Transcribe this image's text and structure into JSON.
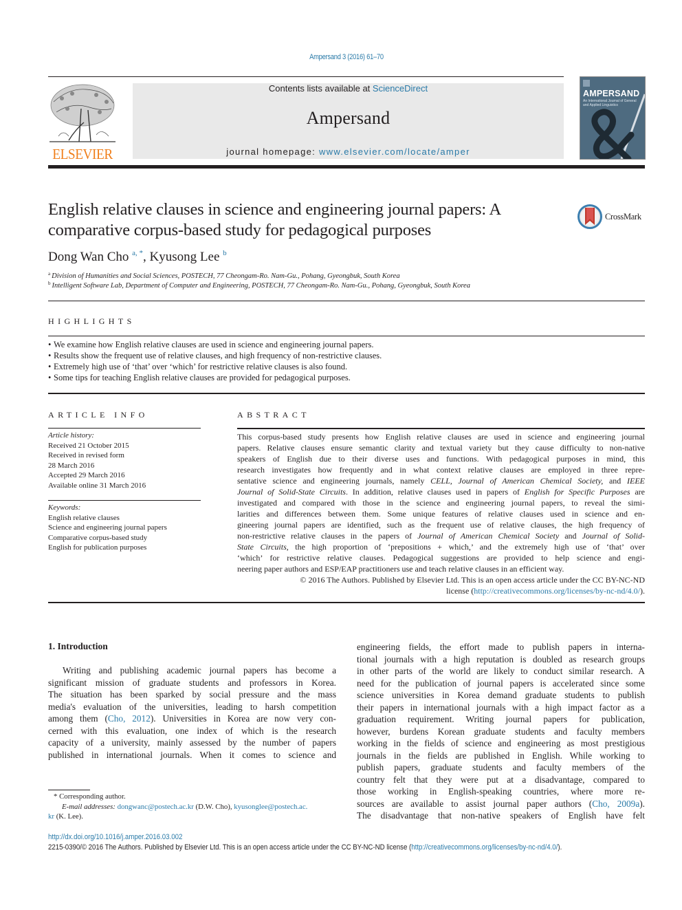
{
  "header": {
    "journal_ref": "Ampersand 3 (2016) 61–70",
    "contents_prefix": "Contents lists available at ",
    "contents_link": "ScienceDirect",
    "journal_name": "Ampersand",
    "homepage_prefix": "journal homepage: ",
    "homepage_link": "www.elsevier.com/locate/amper",
    "publisher_logo_text": "ELSEVIER",
    "cover_title": "AMPERSAND",
    "cover_subtitle": "An International Journal of General and Applied Linguistics"
  },
  "colors": {
    "link": "#2a7aa8",
    "elsevier_orange": "#f07f1b",
    "header_bg": "#e9e9e9",
    "cover_bg": "#4e6b80",
    "text": "#231f20"
  },
  "article": {
    "title": "English relative clauses in science and engineering journal papers: A comparative corpus-based study for pedagogical purposes",
    "crossmark_label": "CrossMark",
    "authors": [
      {
        "name": "Dong Wan Cho",
        "marks": "a, *"
      },
      {
        "name": "Kyusong Lee",
        "marks": "b"
      }
    ],
    "author_separator": ", ",
    "affiliations": [
      {
        "mark": "a",
        "text": "Division of Humanities and Social Sciences, POSTECH, 77 Cheongam-Ro. Nam-Gu., Pohang, Gyeongbuk, South Korea"
      },
      {
        "mark": "b",
        "text": "Intelligent Software Lab, Department of Computer and Engineering, POSTECH, 77 Cheongam-Ro. Nam-Gu., Pohang, Gyeongbuk, South Korea"
      }
    ]
  },
  "highlights": {
    "heading": "HIGHLIGHTS",
    "bullet": "•",
    "items": [
      "We examine how English relative clauses are used in science and engineering journal papers.",
      "Results show the frequent use of relative clauses, and high frequency of non-restrictive clauses.",
      "Extremely high use of ‘that’ over ‘which’ for restrictive relative clauses is also found.",
      "Some tips for teaching English relative clauses are provided for pedagogical purposes."
    ]
  },
  "article_info": {
    "heading": "ARTICLE INFO",
    "history_label": "Article history:",
    "history": [
      "Received 21 October 2015",
      "Received in revised form",
      "28 March 2016",
      "Accepted 29 March 2016",
      "Available online 31 March 2016"
    ],
    "keywords_label": "Keywords:",
    "keywords": [
      "English relative clauses",
      "Science and engineering journal papers",
      "Comparative corpus-based study",
      "English for publication purposes"
    ]
  },
  "abstract": {
    "heading": "ABSTRACT",
    "lines": [
      [
        {
          "t": "This corpus-based study presents how English relative clauses are used in science and engineering journal"
        }
      ],
      [
        {
          "t": "papers. Relative clauses ensure semantic clarity and textual variety but they cause difficulty to non-native"
        }
      ],
      [
        {
          "t": "speakers of English due to their diverse uses and functions. With pedagogical purposes in mind, this"
        }
      ],
      [
        {
          "t": "research investigates how frequently and in what context relative clauses are employed in three repre-"
        }
      ],
      [
        {
          "t": "sentative science and engineering journals, namely "
        },
        {
          "t": "CELL, Journal of American Chemical Society,",
          "i": true
        },
        {
          "t": " and "
        },
        {
          "t": "IEEE",
          "i": true
        }
      ],
      [
        {
          "t": "Journal of Solid-State Circuits",
          "i": true
        },
        {
          "t": ". In addition, relative clauses used in papers of "
        },
        {
          "t": "English for Specific Purposes",
          "i": true
        },
        {
          "t": " are"
        }
      ],
      [
        {
          "t": "investigated and compared with those in the science and engineering journal papers, to reveal the simi-"
        }
      ],
      [
        {
          "t": "larities and differences between them. Some unique features of relative clauses used in science and en-"
        }
      ],
      [
        {
          "t": "gineering journal papers are identified, such as the frequent use of relative clauses, the high frequency of"
        }
      ],
      [
        {
          "t": "non-restrictive relative clauses in the papers of "
        },
        {
          "t": "Journal of American Chemical Society",
          "i": true
        },
        {
          "t": " and "
        },
        {
          "t": "Journal of Solid-",
          "i": true
        }
      ],
      [
        {
          "t": "State Circuits",
          "i": true
        },
        {
          "t": ", the high proportion of ‘prepositions + which,’ and the extremely high use of ‘that’ over"
        }
      ],
      [
        {
          "t": "‘which’ for restrictive relative clauses. Pedagogical suggestions are provided to help science and engi-"
        }
      ],
      [
        {
          "t": "neering paper authors and ESP/EAP practitioners use and teach relative clauses in an efficient way."
        }
      ]
    ],
    "copyright_line1": "© 2016 The Authors. Published by Elsevier Ltd. This is an open access article under the CC BY-NC-ND",
    "license_prefix": "license (",
    "license_link": "http://creativecommons.org/licenses/by-nc-nd/4.0/",
    "license_suffix": ")."
  },
  "body": {
    "section_heading": "1.  Introduction",
    "left_lines": [
      [
        {
          "t": "Writing and publishing academic journal papers has become a"
        }
      ],
      [
        {
          "t": "significant mission of graduate students and professors in Korea."
        }
      ],
      [
        {
          "t": "The situation has been sparked by social pressure and the mass"
        }
      ],
      [
        {
          "t": "media's evaluation of the universities, leading to harsh competition"
        }
      ],
      [
        {
          "t": "among them ("
        },
        {
          "t": "Cho, 2012",
          "link": true
        },
        {
          "t": "). Universities in Korea are now very con-"
        }
      ],
      [
        {
          "t": "cerned with this evaluation, one index of which is the research"
        }
      ],
      [
        {
          "t": "capacity of a university, mainly assessed by the number of papers"
        }
      ],
      [
        {
          "t": "published in international journals. When it comes to science and"
        }
      ]
    ],
    "right_lines": [
      [
        {
          "t": "engineering fields, the effort made to publish papers in interna-"
        }
      ],
      [
        {
          "t": "tional journals with a high reputation is doubled as research groups"
        }
      ],
      [
        {
          "t": "in other parts of the world are likely to conduct similar research. A"
        }
      ],
      [
        {
          "t": "need for the publication of journal papers is accelerated since some"
        }
      ],
      [
        {
          "t": "science universities in Korea demand graduate students to publish"
        }
      ],
      [
        {
          "t": "their papers in international journals with a high impact factor as a"
        }
      ],
      [
        {
          "t": "graduation requirement. Writing journal papers for publication,"
        }
      ],
      [
        {
          "t": "however, burdens Korean graduate students and faculty members"
        }
      ],
      [
        {
          "t": "working in the fields of science and engineering as most prestigious"
        }
      ],
      [
        {
          "t": "journals in the fields are published in English. While working to"
        }
      ],
      [
        {
          "t": "publish papers, graduate students and faculty members of the"
        }
      ],
      [
        {
          "t": "country felt that they were put at a disadvantage, compared to"
        }
      ],
      [
        {
          "t": "those working in English-speaking countries, where more re-"
        }
      ],
      [
        {
          "t": "sources are available to assist journal paper authors ("
        },
        {
          "t": "Cho, 2009a",
          "link": true
        },
        {
          "t": ")."
        }
      ],
      [
        {
          "t": "The disadvantage that non-native speakers of English have felt"
        }
      ]
    ]
  },
  "footnote": {
    "corresponding": "* Corresponding author.",
    "email_label": "E-mail addresses:",
    "email1": "dongwanc@postech.ac.kr",
    "email1_owner": " (D.W. Cho), ",
    "email2_part1": "kyusonglee@postech.ac.",
    "email2_part2": "kr",
    "email2_owner": " (K. Lee)."
  },
  "footer": {
    "doi": "http://dx.doi.org/10.1016/j.amper.2016.03.002",
    "issn_text": "2215-0390/© 2016 The Authors. Published by Elsevier Ltd. This is an open access article under the CC BY-NC-ND license (",
    "license_link": "http://creativecommons.org/licenses/by-nc-nd/4.0/",
    "license_suffix": ")."
  }
}
